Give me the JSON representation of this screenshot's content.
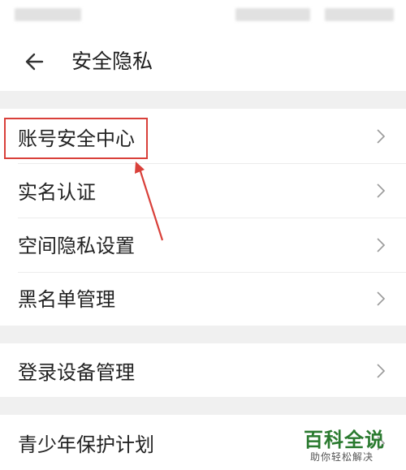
{
  "header": {
    "title": "安全隐私",
    "back_icon": "arrow-left-icon"
  },
  "menu": {
    "items": [
      {
        "label": "账号安全中心",
        "icon": "chevron-right-icon",
        "highlighted": true
      },
      {
        "label": "实名认证",
        "icon": "chevron-right-icon"
      },
      {
        "label": "空间隐私设置",
        "icon": "chevron-right-icon"
      },
      {
        "label": "黑名单管理",
        "icon": "chevron-right-icon"
      },
      {
        "label": "登录设备管理",
        "icon": "chevron-right-icon"
      },
      {
        "label": "青少年保护计划",
        "icon": "chevron-right-icon"
      }
    ]
  },
  "annotation": {
    "color": "#d9403a"
  },
  "watermark": {
    "main": "百科全说",
    "sub": "助你轻松解决",
    "color": "#2a7a2f"
  }
}
